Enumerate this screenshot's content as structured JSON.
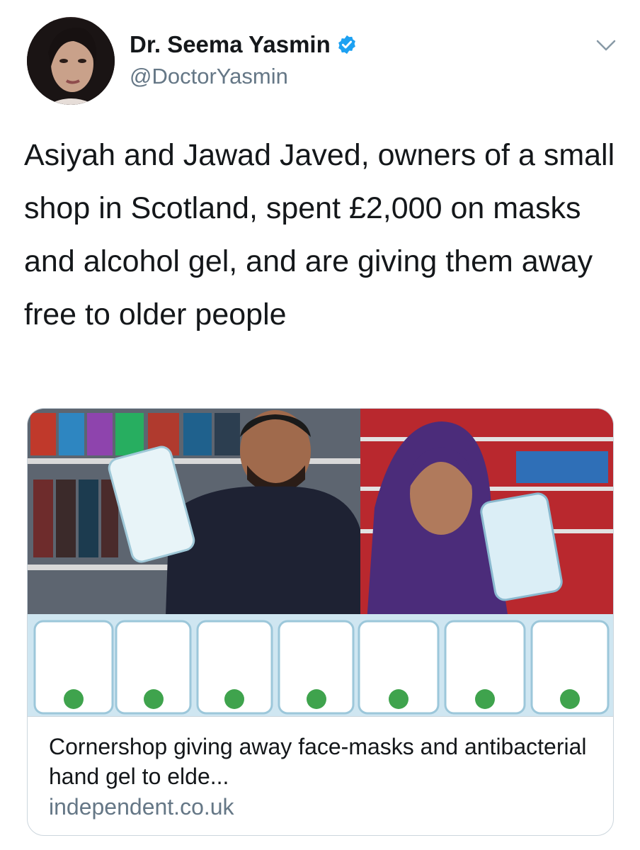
{
  "tweet": {
    "author": {
      "display_name": "Dr. Seema Yasmin",
      "handle": "@DoctorYasmin",
      "verified": true,
      "avatar_icon": "profile-photo"
    },
    "more_icon": "chevron-down-icon",
    "text": "Asiyah and Jawad Javed, owners of a small shop in Scotland, spent £2,000 on masks and alcohol gel, and are giving them away free to older people"
  },
  "link_card": {
    "image_icon": "shop-owners-photo",
    "title": "Cornershop giving away face-masks and antibacterial hand gel to elde...",
    "domain": "independent.co.uk"
  },
  "colors": {
    "text_primary": "#14171a",
    "text_secondary": "#657786",
    "verified_blue": "#1da1f2",
    "card_border": "#ccd6dd"
  }
}
